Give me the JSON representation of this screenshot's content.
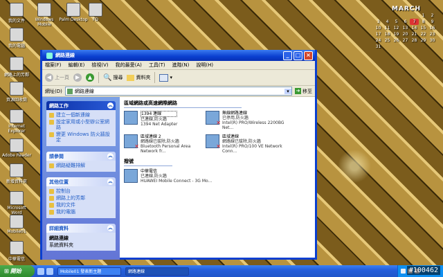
{
  "desktop": {
    "icons": [
      {
        "label": "我的文件"
      },
      {
        "label": "Windows Mobile"
      },
      {
        "label": "Palm Desktop"
      },
      {
        "label": "FD"
      },
      {
        "label": "我的電腦"
      },
      {
        "label": "網路上的芳鄰"
      },
      {
        "label": "資源回收筒"
      },
      {
        "label": "Internet Explorer"
      },
      {
        "label": "Adobe Reader"
      },
      {
        "label": "新增資料夾"
      },
      {
        "label": "Microsoft Word"
      },
      {
        "label": "Mobile01"
      },
      {
        "label": "中華電信"
      }
    ]
  },
  "calendar": {
    "month": "MARCH",
    "days": [
      "",
      "",
      "",
      "",
      "",
      "1",
      "2",
      "3",
      "4",
      "5",
      "6",
      "7",
      "8",
      "9",
      "10",
      "11",
      "12",
      "13",
      "14",
      "15",
      "16",
      "17",
      "18",
      "19",
      "20",
      "21",
      "22",
      "23",
      "24",
      "25",
      "26",
      "27",
      "28",
      "29",
      "30",
      "31"
    ],
    "today_index": 11
  },
  "window": {
    "title": "網路連線",
    "menu": [
      "檔案(F)",
      "編輯(E)",
      "檢視(V)",
      "我的最愛(A)",
      "工具(T)",
      "進階(N)",
      "說明(H)"
    ],
    "toolbar": {
      "back": "上一頁",
      "search": "搜尋",
      "folders": "資料夾"
    },
    "address": {
      "label": "網址(D)",
      "value": "網路連線",
      "go": "移至"
    },
    "taskpane": {
      "network_tasks": {
        "title": "網路工作",
        "links": [
          "建立一個新連線",
          "設定家用或小型辦公室網路",
          "變更 Windows 防火牆設定"
        ]
      },
      "see_also": {
        "title": "請參閱",
        "links": [
          "網路疑難排解"
        ]
      },
      "other_places": {
        "title": "其他位置",
        "links": [
          "控制台",
          "網路上的芳鄰",
          "我的文件",
          "我的電腦"
        ]
      },
      "details": {
        "title": "詳細資料",
        "name": "網路連線",
        "desc": "系統資料夾"
      }
    },
    "groups": [
      {
        "title": "區域網路或高速網際網路",
        "items": [
          {
            "name": "1394 連線",
            "status": "已連線,防火牆",
            "device": "1394 Net Adapter",
            "error": false,
            "selected": true
          },
          {
            "name": "無線網路連線",
            "status": "已停用,防火牆",
            "device": "Intel(R) PRO/Wireless 2200BG Net...",
            "error": true,
            "selected": false
          },
          {
            "name": "區域連線 2",
            "status": "網路線已拔除,防火牆",
            "device": "Bluetooth Personal Area Network fr...",
            "error": true,
            "selected": false
          },
          {
            "name": "區域連線",
            "status": "網路線已拔除,防火牆",
            "device": "Intel(R) PRO/100 VE Network Conn...",
            "error": true,
            "selected": false
          }
        ]
      },
      {
        "title": "撥號",
        "items": [
          {
            "name": "中華電信",
            "status": "已連線,防火牆",
            "device": "HUAWEI Mobile Connect - 3G Mo...",
            "error": false,
            "selected": false
          }
        ]
      }
    ]
  },
  "taskbar": {
    "start": "開始",
    "tasks": [
      {
        "label": "Mobile01 發表新主題",
        "active": false
      },
      {
        "label": "網路連線",
        "active": true
      }
    ]
  },
  "watermark": "#100462",
  "colors": {
    "titlebar": "#0a3fd0",
    "taskpane": "#6375d6",
    "taskbar": "#245edb",
    "start": "#2e8b2e"
  }
}
